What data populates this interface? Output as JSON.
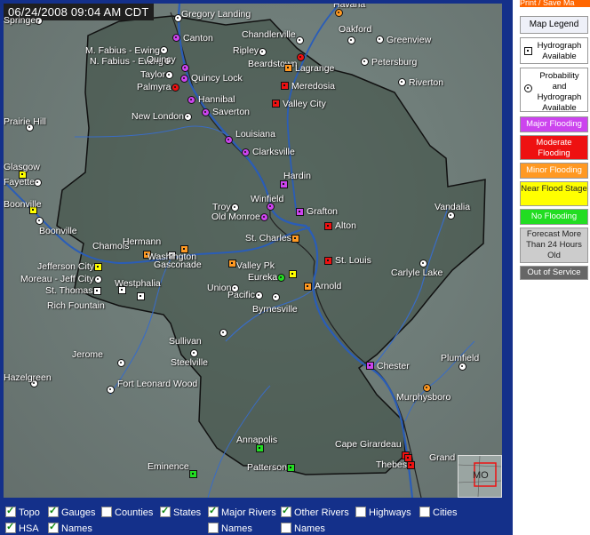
{
  "timestamp": "06/24/2008 09:04 AM CDT",
  "print_button": "Print / Save Ma",
  "legend": {
    "title": "Map Legend",
    "items": [
      {
        "label": "Hydrograph Available"
      },
      {
        "label": "Probability and Hydrograph Available"
      },
      {
        "label": "Major Flooding",
        "color": "#cc44ee"
      },
      {
        "label": "Moderate Flooding",
        "color": "#ee1111"
      },
      {
        "label": "Minor Flooding",
        "color": "#ff9922"
      },
      {
        "label": "Near Flood Stage",
        "color": "#ffff00"
      },
      {
        "label": "No Flooding",
        "color": "#22dd22"
      },
      {
        "label": "Forecast More Than 24 Hours Old",
        "color": "#cccccc"
      },
      {
        "label": "Out of Service",
        "color": "#666666"
      }
    ]
  },
  "controls": [
    {
      "label": "Topo",
      "checked": true
    },
    {
      "label": "Gauges",
      "checked": true
    },
    {
      "label": "Counties",
      "checked": false
    },
    {
      "label": "States",
      "checked": true
    },
    {
      "label": "Major Rivers",
      "checked": true
    },
    {
      "label": "Other Rivers",
      "checked": true
    },
    {
      "label": "Highways",
      "checked": false
    },
    {
      "label": "Cities",
      "checked": false
    },
    {
      "label": "HSA",
      "checked": true
    },
    {
      "label": "Names",
      "checked": true
    },
    {
      "label": "Names",
      "checked": false
    },
    {
      "label": "Names",
      "checked": false
    }
  ],
  "places": [
    {
      "name": "Havana",
      "status": "minor"
    },
    {
      "name": "Gregory Landing",
      "status": "hydro"
    },
    {
      "name": "Canton",
      "status": "major"
    },
    {
      "name": "Chandlerville",
      "status": "hydro"
    },
    {
      "name": "Oakford",
      "status": "hydro"
    },
    {
      "name": "Greenview",
      "status": "hydro"
    },
    {
      "name": "M. Fabius - Ewing",
      "status": "hydro"
    },
    {
      "name": "N. Fabius - Ewing",
      "status": "hydro"
    },
    {
      "name": "Quincy",
      "status": "major"
    },
    {
      "name": "Ripley",
      "status": "hydro"
    },
    {
      "name": "Beardstown",
      "status": "moderate"
    },
    {
      "name": "Lagrange",
      "status": "minor"
    },
    {
      "name": "Petersburg",
      "status": "hydro"
    },
    {
      "name": "Taylor",
      "status": "hydro"
    },
    {
      "name": "Quincy Lock",
      "status": "major"
    },
    {
      "name": "Palmyra",
      "status": "moderate"
    },
    {
      "name": "Meredosia",
      "status": "moderate"
    },
    {
      "name": "Riverton",
      "status": "hydro"
    },
    {
      "name": "Hannibal",
      "status": "major"
    },
    {
      "name": "Valley City",
      "status": "moderate"
    },
    {
      "name": "Saverton",
      "status": "major"
    },
    {
      "name": "New London",
      "status": "hydro"
    },
    {
      "name": "Prairie Hill",
      "status": "hydro"
    },
    {
      "name": "Louisiana",
      "status": "major"
    },
    {
      "name": "Clarksville",
      "status": "major"
    },
    {
      "name": "Glasgow",
      "status": "near"
    },
    {
      "name": "Fayette",
      "status": "hydro"
    },
    {
      "name": "Hardin",
      "status": "major"
    },
    {
      "name": "Boonville",
      "status": "near"
    },
    {
      "name": "Winfield",
      "status": "major"
    },
    {
      "name": "Troy",
      "status": "hydro"
    },
    {
      "name": "Grafton",
      "status": "major"
    },
    {
      "name": "Vandalia",
      "status": "hydro"
    },
    {
      "name": "Old Monroe",
      "status": "major"
    },
    {
      "name": "Boonville",
      "status": "hydro"
    },
    {
      "name": "Alton",
      "status": "moderate"
    },
    {
      "name": "Chamois",
      "status": "minor"
    },
    {
      "name": "Hermann",
      "status": "minor"
    },
    {
      "name": "St. Charles",
      "status": "minor"
    },
    {
      "name": "Gasconade",
      "status": "hydro"
    },
    {
      "name": "Washington",
      "status": "minor"
    },
    {
      "name": "Jefferson City",
      "status": "near"
    },
    {
      "name": "St. Louis",
      "status": "moderate"
    },
    {
      "name": "Valley Pk",
      "status": "near"
    },
    {
      "name": "Carlyle Lake",
      "status": "hydro"
    },
    {
      "name": "Moreau - Jeff City",
      "status": "hydro"
    },
    {
      "name": "Westphalia",
      "status": "hydro"
    },
    {
      "name": "Eureka",
      "status": "none"
    },
    {
      "name": "St. Thomas",
      "status": "hydro"
    },
    {
      "name": "Union",
      "status": "hydro"
    },
    {
      "name": "Arnold",
      "status": "minor"
    },
    {
      "name": "Pacific",
      "status": "hydro"
    },
    {
      "name": "Rich Fountain",
      "status": "hydro"
    },
    {
      "name": "Byrnesville",
      "status": "hydro"
    },
    {
      "name": "Sullivan",
      "status": "hydro"
    },
    {
      "name": "Jerome",
      "status": "hydro"
    },
    {
      "name": "Steelville",
      "status": "hydro"
    },
    {
      "name": "Plumfield",
      "status": "hydro"
    },
    {
      "name": "Chester",
      "status": "major"
    },
    {
      "name": "Hazelgreen",
      "status": "hydro"
    },
    {
      "name": "Fort Leonard Wood",
      "status": "hydro"
    },
    {
      "name": "Murphysboro",
      "status": "minor"
    },
    {
      "name": "Cape Girardeau",
      "status": "moderate"
    },
    {
      "name": "Annapolis",
      "status": "none"
    },
    {
      "name": "Grand",
      "status": "moderate"
    },
    {
      "name": "Eminence",
      "status": "none"
    },
    {
      "name": "Patterson",
      "status": "none"
    },
    {
      "name": "Thebes",
      "status": "moderate"
    },
    {
      "name": "Springer",
      "status": "hydro"
    }
  ],
  "inset_label": "MO"
}
